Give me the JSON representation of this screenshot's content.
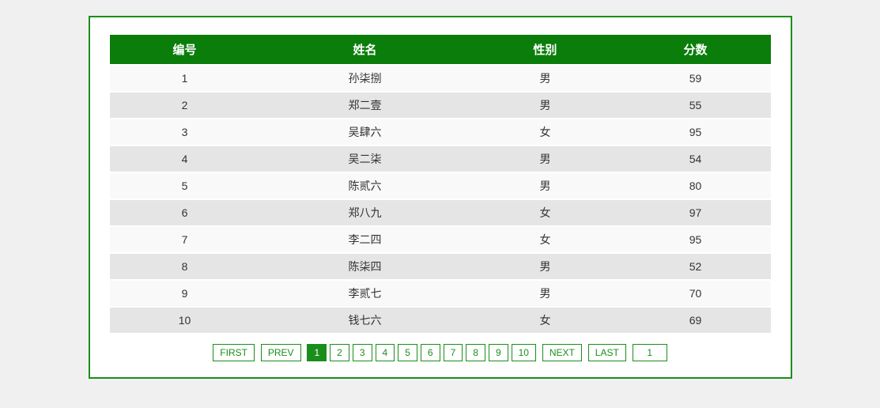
{
  "table": {
    "headers": [
      "编号",
      "姓名",
      "性别",
      "分数"
    ],
    "rows": [
      {
        "id": "1",
        "name": "孙柒捌",
        "gender": "男",
        "score": "59"
      },
      {
        "id": "2",
        "name": "郑二壹",
        "gender": "男",
        "score": "55"
      },
      {
        "id": "3",
        "name": "吴肆六",
        "gender": "女",
        "score": "95"
      },
      {
        "id": "4",
        "name": "吴二柒",
        "gender": "男",
        "score": "54"
      },
      {
        "id": "5",
        "name": "陈贰六",
        "gender": "男",
        "score": "80"
      },
      {
        "id": "6",
        "name": "郑八九",
        "gender": "女",
        "score": "97"
      },
      {
        "id": "7",
        "name": "李二四",
        "gender": "女",
        "score": "95"
      },
      {
        "id": "8",
        "name": "陈柒四",
        "gender": "男",
        "score": "52"
      },
      {
        "id": "9",
        "name": "李贰七",
        "gender": "男",
        "score": "70"
      },
      {
        "id": "10",
        "name": "钱七六",
        "gender": "女",
        "score": "69"
      }
    ]
  },
  "pagination": {
    "first": "FIRST",
    "prev": "PREV",
    "pages": [
      "1",
      "2",
      "3",
      "4",
      "5",
      "6",
      "7",
      "8",
      "9",
      "10"
    ],
    "active_index": 0,
    "next": "NEXT",
    "last": "LAST",
    "input_value": "1"
  }
}
